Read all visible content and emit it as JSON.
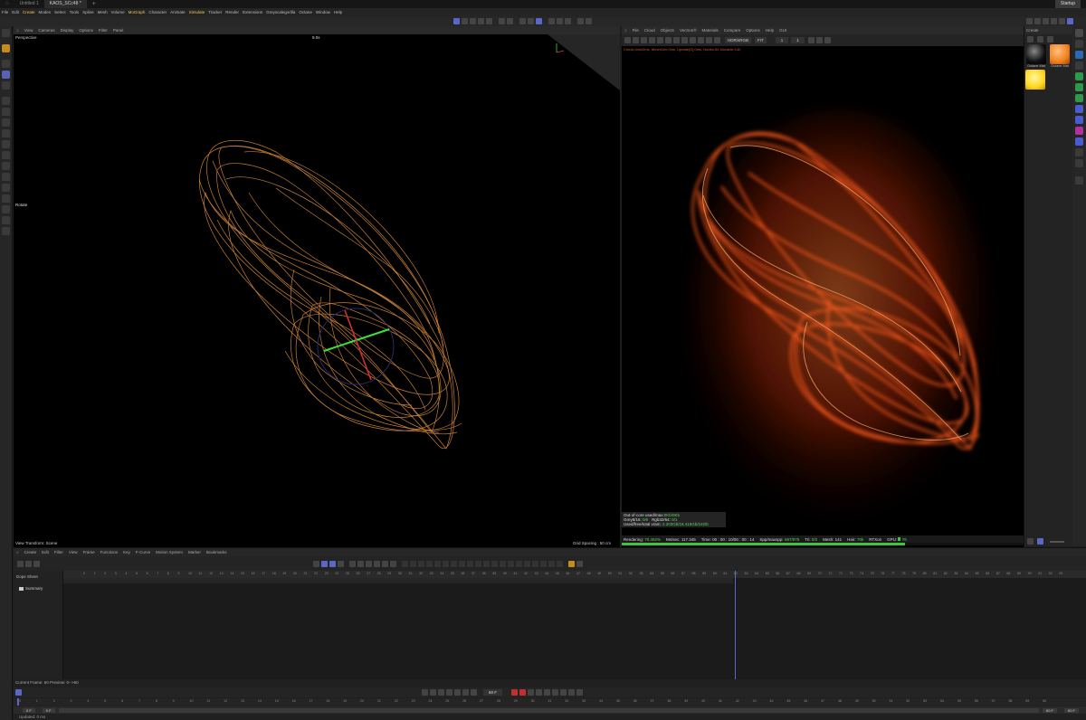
{
  "titlebar": {
    "tabs": [
      "Untitled 1",
      "KAOS_SCc48 *"
    ],
    "right_button": "Startup"
  },
  "menu": [
    "File",
    "Edit",
    "Create",
    "Modes",
    "Select",
    "Tools",
    "Spline",
    "Mesh",
    "Volume",
    "MoGraph",
    "Character",
    "Animate",
    "Simulate",
    "Tracker",
    "Render",
    "Extensions",
    "Greyscalegorilla",
    "Octane",
    "Window",
    "Help"
  ],
  "viewport": {
    "menu": [
      "View",
      "Cameras",
      "Display",
      "Options",
      "Filter",
      "Panel"
    ],
    "camera_label": "Perspective",
    "fps": "9.0s",
    "mode_label": "Rotate",
    "transform_label": "View Transform: Scene",
    "grid_label": "Grid Spacing : 50 cm"
  },
  "liveviewer": {
    "menu": [
      "File",
      "Cloud",
      "Objects",
      "Vectron®",
      "Materials",
      "Compare",
      "Options",
      "Help",
      "GUI"
    ],
    "colorspace": "HDR/sRGB",
    "tonemap": "FIT",
    "value_a": "1",
    "value_b": "1",
    "status_line": "Check:0ms/0ms. MeshGen:0ms. Update[G]:0ms. Nodes:54 Movable:140",
    "stats": {
      "out_of_core_label": "Out-of-core used/max:",
      "out_of_core_value": "0Kb/0Kb",
      "grey_label": "Grey8/16:",
      "grey_value": "0/0",
      "rgb_label": "Rgb32/64:",
      "rgb_value": "0/1",
      "vram_label": "Used/free/total vram:",
      "vram_value": "2.203Gb/18.416Gb/24Gb",
      "rendering_label": "Rendering:",
      "rendering_value": "70.462%",
      "ms_label": "Ms/sec:",
      "ms_value": "117.345",
      "time_label": "Time:",
      "time_value": "00 : 00 : 10/00 : 00 : 14",
      "spp_label": "Spp/maxspp:",
      "spp_value": "687/975",
      "tri_label": "Tri:",
      "tri_value": "0/2",
      "mesh_label": "Mesh:",
      "mesh_value": "141",
      "hair_label": "Hair:",
      "hair_value": "70k",
      "rtx_label": "RTXon",
      "gpu_label": "GPU:",
      "gpu_value": "76",
      "progress": 0.70462
    }
  },
  "materials": {
    "create_label": "Create",
    "items": [
      "Octane Mat",
      "Octane Mat"
    ]
  },
  "timeline": {
    "menu": [
      "Create",
      "Edit",
      "Filter",
      "View",
      "Frame",
      "Functions",
      "Key",
      "F-Curve",
      "Motion System",
      "Marker",
      "Bookmarks"
    ],
    "dope_label": "Dope Sheet",
    "summary_label": "Summary",
    "current_frame_text": "Current Frame: 60  Preview: 0-->60",
    "frame_field": "60 F",
    "start_field": "0 F",
    "start_field2": "0 F",
    "end_field": "60 F",
    "end_field2": "60 F",
    "status_text": "Updated: 0 ms"
  },
  "colors": {
    "accent": "#5b67c6",
    "trail_orange": "#e8953c",
    "render_orange": "#ff5a1e",
    "progress_green": "#3ec43e"
  }
}
